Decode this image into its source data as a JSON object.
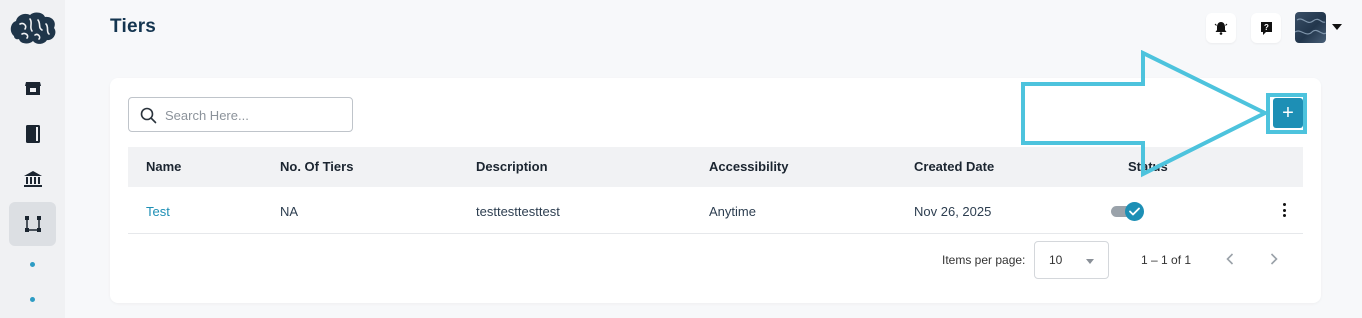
{
  "page": {
    "title": "Tiers"
  },
  "sidebar": {
    "items": [
      {
        "icon": "store-icon",
        "active": false
      },
      {
        "icon": "book-icon",
        "active": false
      },
      {
        "icon": "bank-icon",
        "active": false
      },
      {
        "icon": "tiers-icon",
        "active": true
      }
    ]
  },
  "topbar": {
    "icons": [
      "notification-bell-icon",
      "help-icon"
    ],
    "avatar": "user-avatar"
  },
  "search": {
    "placeholder": "Search Here..."
  },
  "table": {
    "columns": [
      "Name",
      "No. Of Tiers",
      "Description",
      "Accessibility",
      "Created Date",
      "Status"
    ],
    "rows": [
      {
        "name": "Test",
        "tiers": "NA",
        "description": "testtesttesttest",
        "accessibility": "Anytime",
        "created": "Nov 26, 2025",
        "status": true
      }
    ]
  },
  "pagination": {
    "items_per_page_label": "Items per page:",
    "items_per_page": "10",
    "range": "1 – 1 of 1"
  },
  "add_button": {
    "label": "+"
  },
  "colors": {
    "accent": "#1d8fb5",
    "callout": "#4dc3dd",
    "title": "#143550"
  }
}
